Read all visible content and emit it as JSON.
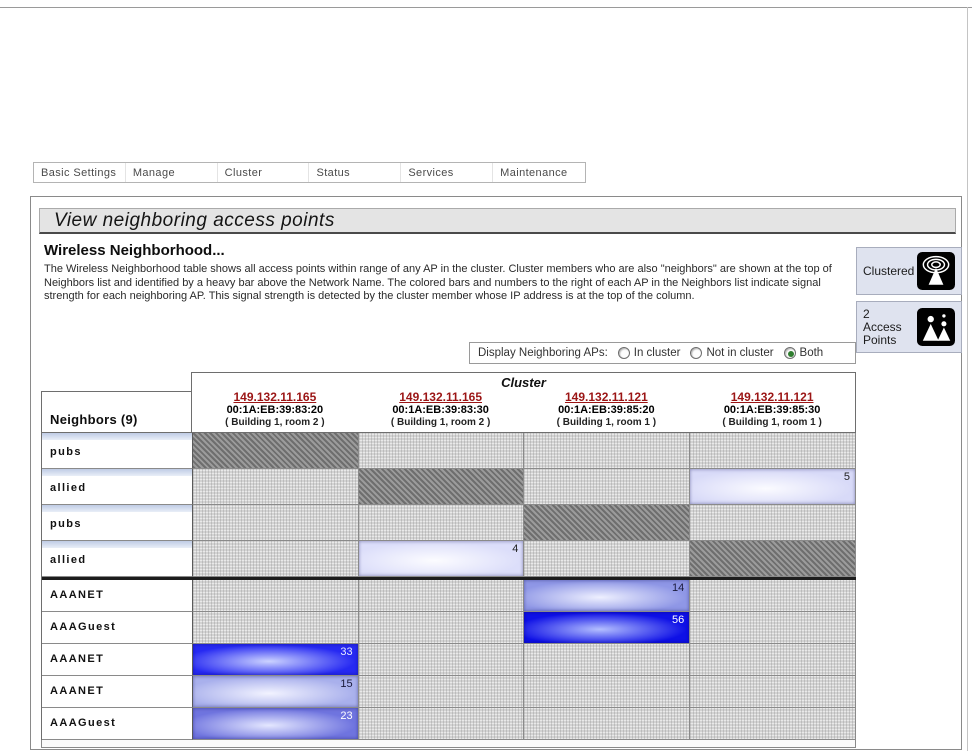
{
  "nav": {
    "items": [
      "Basic Settings",
      "Manage",
      "Cluster",
      "Status",
      "Services",
      "Maintenance"
    ]
  },
  "page": {
    "title": "View neighboring access points"
  },
  "intro": {
    "heading": "Wireless Neighborhood...",
    "body": "The Wireless Neighborhood table shows all access points within range of any AP in the cluster. Cluster members who are also \"neighbors\" are shown at the top of Neighbors list and identified by a heavy bar above the Network Name. The colored bars and numbers to the right of each AP in the Neighbors list indicate signal strength for each neighboring AP. This signal strength is detected by the cluster member whose IP address is at the top of the column."
  },
  "sidebar": {
    "clustered": {
      "label": "Clustered"
    },
    "access_points": {
      "count": "2",
      "label": "Access Points"
    }
  },
  "filter": {
    "label": "Display Neighboring APs:",
    "options": [
      {
        "label": "In cluster",
        "selected": false
      },
      {
        "label": "Not in cluster",
        "selected": false
      },
      {
        "label": "Both",
        "selected": true
      }
    ]
  },
  "table": {
    "cluster_header": "Cluster",
    "neighbors_header": "Neighbors (9)",
    "columns": [
      {
        "ip": "149.132.11.165",
        "mac": "00:1A:EB:39:83:20",
        "location": "( Building 1, room 2 )"
      },
      {
        "ip": "149.132.11.165",
        "mac": "00:1A:EB:39:83:30",
        "location": "( Building 1, room 2 )"
      },
      {
        "ip": "149.132.11.121",
        "mac": "00:1A:EB:39:85:20",
        "location": "( Building 1, room 1 )"
      },
      {
        "ip": "149.132.11.121",
        "mac": "00:1A:EB:39:85:30",
        "location": "( Building 1, room 1 )"
      }
    ],
    "rows": [
      {
        "name": "pubs",
        "in_cluster": true,
        "cells": [
          {
            "type": "self"
          },
          {
            "type": "none"
          },
          {
            "type": "none"
          },
          {
            "type": "none"
          }
        ]
      },
      {
        "name": "allied",
        "in_cluster": true,
        "cells": [
          {
            "type": "none"
          },
          {
            "type": "self"
          },
          {
            "type": "none"
          },
          {
            "type": "signal",
            "value": "5"
          }
        ]
      },
      {
        "name": "pubs",
        "in_cluster": true,
        "cells": [
          {
            "type": "none"
          },
          {
            "type": "none"
          },
          {
            "type": "self"
          },
          {
            "type": "none"
          }
        ]
      },
      {
        "name": "allied",
        "in_cluster": true,
        "cells": [
          {
            "type": "none"
          },
          {
            "type": "signal",
            "value": "4"
          },
          {
            "type": "none"
          },
          {
            "type": "self"
          }
        ]
      },
      {
        "name": "AAANET",
        "in_cluster": false,
        "cells": [
          {
            "type": "none"
          },
          {
            "type": "none"
          },
          {
            "type": "signal",
            "value": "14"
          },
          {
            "type": "none"
          }
        ]
      },
      {
        "name": "AAAGuest",
        "in_cluster": false,
        "cells": [
          {
            "type": "none"
          },
          {
            "type": "none"
          },
          {
            "type": "signal",
            "value": "56"
          },
          {
            "type": "none"
          }
        ]
      },
      {
        "name": "AAANET",
        "in_cluster": false,
        "cells": [
          {
            "type": "signal",
            "value": "33"
          },
          {
            "type": "none"
          },
          {
            "type": "none"
          },
          {
            "type": "none"
          }
        ]
      },
      {
        "name": "AAANET",
        "in_cluster": false,
        "cells": [
          {
            "type": "signal",
            "value": "15"
          },
          {
            "type": "none"
          },
          {
            "type": "none"
          },
          {
            "type": "none"
          }
        ]
      },
      {
        "name": "AAAGuest",
        "in_cluster": false,
        "cells": [
          {
            "type": "signal",
            "value": "23"
          },
          {
            "type": "none"
          },
          {
            "type": "none"
          },
          {
            "type": "none"
          }
        ]
      }
    ]
  },
  "colors": {
    "link": "#9b1515",
    "selected_radio": "#2f7d2f",
    "signal_styles": {
      "4": {
        "edge": "#dcdefa",
        "center": "#fcfcff",
        "text": "#222222"
      },
      "5": {
        "edge": "#d8daf8",
        "center": "#fbfbff",
        "text": "#222222"
      },
      "14": {
        "edge": "#8f97e6",
        "center": "#eef0ff",
        "text": "#1a1a3a"
      },
      "15": {
        "edge": "#a9b0ec",
        "center": "#f2f3ff",
        "text": "#1a1a3a"
      },
      "23": {
        "edge": "#6f74df",
        "center": "#e4e7ff",
        "text": "#ffffff"
      },
      "33": {
        "edge": "#2629f2",
        "center": "#ccd3ff",
        "text": "#e6ebff"
      },
      "56": {
        "edge": "#0e10e6",
        "center": "#b4bfff",
        "text": "#ffffff"
      }
    }
  }
}
